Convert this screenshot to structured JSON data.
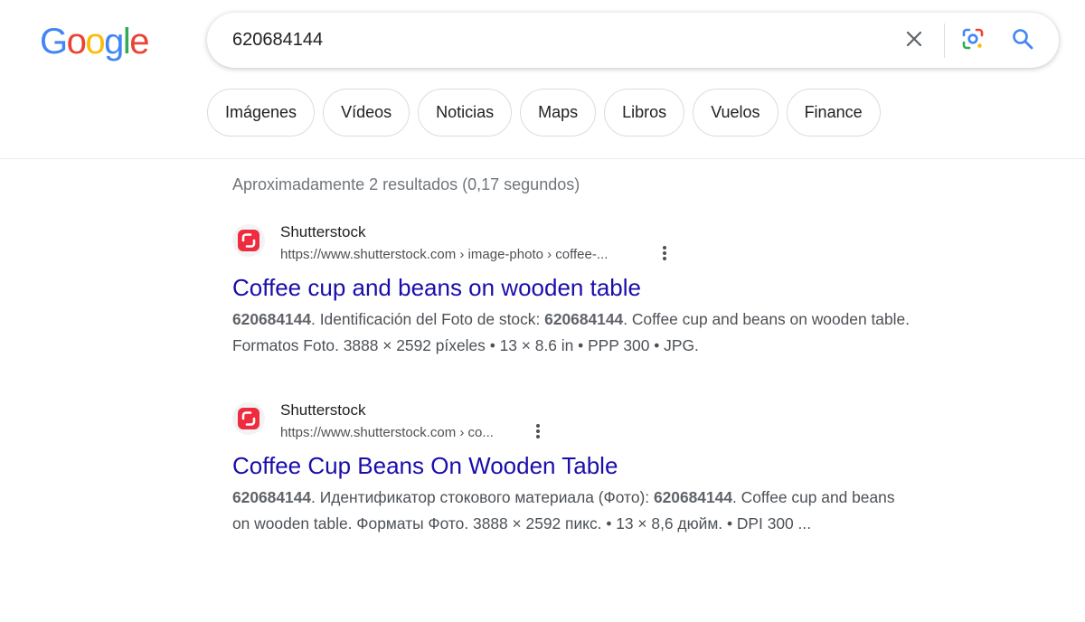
{
  "logo": {
    "letters": [
      "G",
      "o",
      "o",
      "g",
      "l",
      "e"
    ],
    "colors": [
      "#4285F4",
      "#EA4335",
      "#FBBC05",
      "#4285F4",
      "#34A853",
      "#EA4335"
    ]
  },
  "search": {
    "query": "620684144"
  },
  "icons": {
    "clear": "close-icon",
    "lens": "google-lens-icon",
    "search": "search-icon",
    "favicon": "shutterstock-logo-icon",
    "more": "more-vertical-icon"
  },
  "chips": [
    {
      "label": "Imágenes"
    },
    {
      "label": "Vídeos"
    },
    {
      "label": "Noticias"
    },
    {
      "label": "Maps"
    },
    {
      "label": "Libros"
    },
    {
      "label": "Vuelos"
    },
    {
      "label": "Finance"
    }
  ],
  "result_stats": "Aproximadamente 2 resultados (0,17 segundos)",
  "results": [
    {
      "site_name": "Shutterstock",
      "url": "https://www.shutterstock.com › image-photo › coffee-...",
      "title": "Coffee cup and beans on wooden table",
      "snippet_lines": [
        [
          {
            "text": "620684144",
            "bold": true
          },
          {
            "text": ". Identificación del Foto de stock: ",
            "bold": false
          },
          {
            "text": "620684144",
            "bold": true
          },
          {
            "text": ". Coffee cup and beans on wooden table.",
            "bold": false
          }
        ],
        [
          {
            "text": "Formatos Foto. 3888 × 2592 píxeles • 13 × 8.6 in • PPP 300 • JPG.",
            "bold": false
          }
        ]
      ]
    },
    {
      "site_name": "Shutterstock",
      "url": "https://www.shutterstock.com › co...",
      "title": "Coffee Cup Beans On Wooden Table",
      "snippet_lines": [
        [
          {
            "text": "620684144",
            "bold": true
          },
          {
            "text": ". Идентификатор стокового материала (Фото): ",
            "bold": false
          },
          {
            "text": "620684144",
            "bold": true
          },
          {
            "text": ". Coffee cup and beans",
            "bold": false
          }
        ],
        [
          {
            "text": "on wooden table. Форматы Фото. 3888 × 2592 пикс. • 13 × 8,6 дюйм. • DPI 300 ...",
            "bold": false
          }
        ]
      ]
    }
  ],
  "colors": {
    "link": "#1a0dab",
    "favicon_red": "#EE2B3F",
    "icon_gray": "#5f6368",
    "search_blue": "#4285F4"
  }
}
